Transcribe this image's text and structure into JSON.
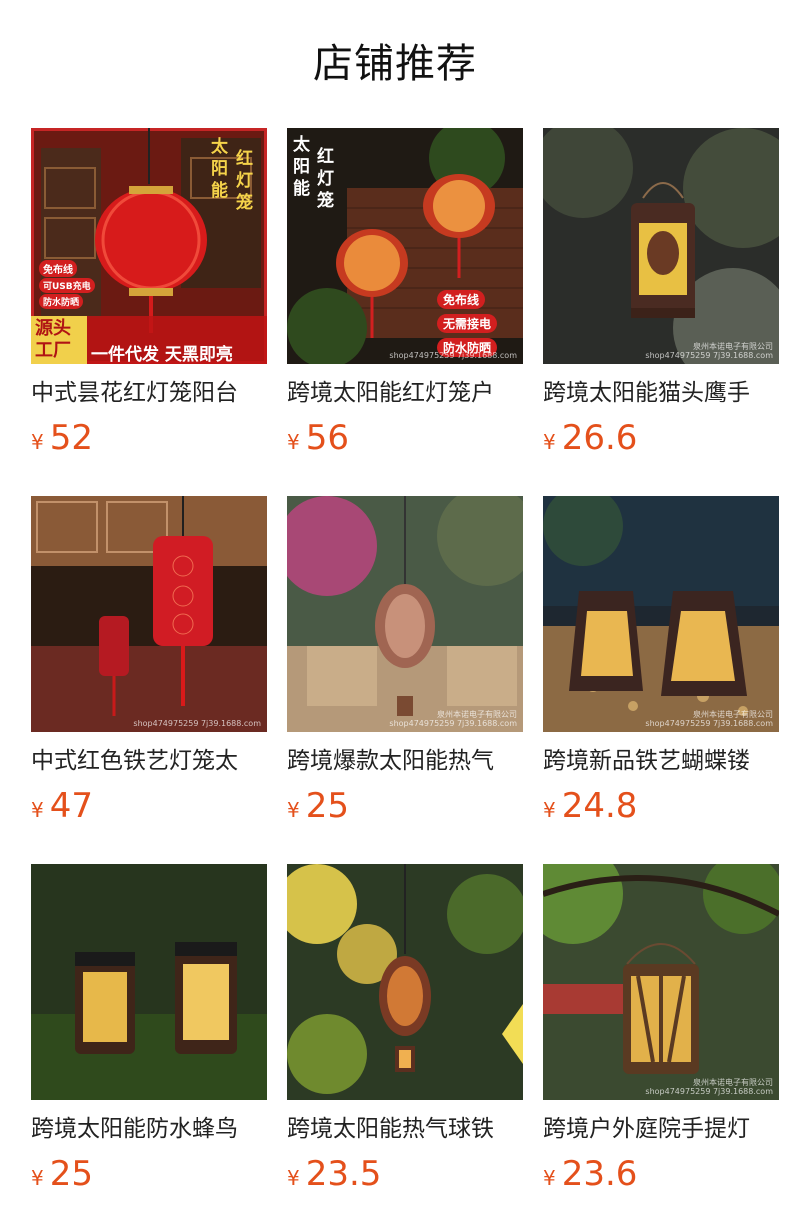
{
  "page": {
    "title": "店铺推荐"
  },
  "colors": {
    "price": "#e4501b",
    "text": "#222222"
  },
  "products": [
    {
      "name": "中式昙花红灯笼阳台",
      "currency": "¥",
      "price": "52",
      "image": "red-lantern-banner-image",
      "overlay": {
        "vertical_title_1": "太阳能",
        "vertical_title_2": "红灯笼",
        "badge_1": "免布线",
        "badge_2": "可USB充电",
        "badge_3": "防水防晒",
        "corner": "源头工厂",
        "banner": "一件代发 天黑即亮"
      }
    },
    {
      "name": "跨境太阳能红灯笼户",
      "currency": "¥",
      "price": "56",
      "image": "double-lantern-image",
      "overlay": {
        "vertical_title_1": "太阳能",
        "vertical_title_2": "红灯笼",
        "badge_1": "免布线",
        "badge_2": "无需接电",
        "badge_3": "防水防晒"
      },
      "watermark": "shop474975259 7j39.1688.com"
    },
    {
      "name": "跨境太阳能猫头鹰手",
      "currency": "¥",
      "price": "26.6",
      "image": "owl-lantern-image",
      "watermark_1": "泉州本诺电子有限公司",
      "watermark_2": "shop474975259 7j39.1688.com"
    },
    {
      "name": "中式红色铁艺灯笼太",
      "currency": "¥",
      "price": "47",
      "image": "red-iron-lantern-image",
      "watermark": "shop474975259 7j39.1688.com"
    },
    {
      "name": "跨境爆款太阳能热气",
      "currency": "¥",
      "price": "25",
      "image": "balloon-lantern-image",
      "watermark_1": "泉州本诺电子有限公司",
      "watermark_2": "shop474975259 7j39.1688.com"
    },
    {
      "name": "跨境新品铁艺蝴蝶镂",
      "currency": "¥",
      "price": "24.8",
      "image": "butterfly-lantern-image",
      "watermark_1": "泉州本诺电子有限公司",
      "watermark_2": "shop474975259 7j39.1688.com"
    },
    {
      "name": "跨境太阳能防水蜂鸟",
      "currency": "¥",
      "price": "25",
      "image": "hummingbird-lantern-image"
    },
    {
      "name": "跨境太阳能热气球铁",
      "currency": "¥",
      "price": "23.5",
      "image": "balloon-iron-lantern-image"
    },
    {
      "name": "跨境户外庭院手提灯",
      "currency": "¥",
      "price": "23.6",
      "image": "rope-lantern-image",
      "watermark_1": "泉州本诺电子有限公司",
      "watermark_2": "shop474975259 7j39.1688.com"
    }
  ]
}
